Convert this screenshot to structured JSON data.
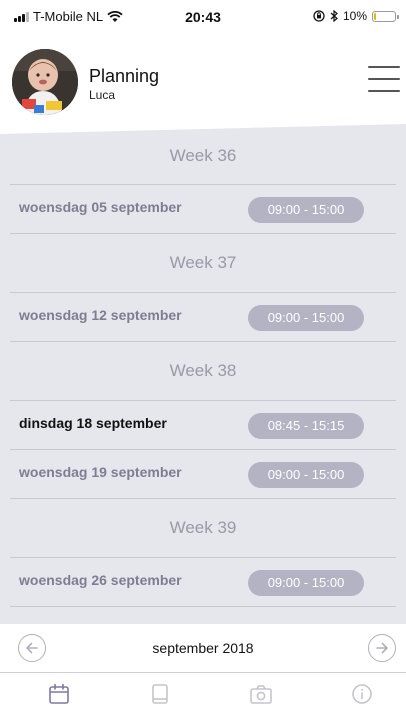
{
  "status_bar": {
    "carrier": "T-Mobile NL",
    "time": "20:43",
    "battery": "10%"
  },
  "header": {
    "title": "Planning",
    "subtitle": "Luca"
  },
  "schedule": {
    "weeks": [
      {
        "label": "Week 36",
        "days": [
          {
            "label": "woensdag 05 september",
            "time": "09:00 - 15:00",
            "current": false
          }
        ]
      },
      {
        "label": "Week 37",
        "days": [
          {
            "label": "woensdag 12 september",
            "time": "09:00 - 15:00",
            "current": false
          }
        ]
      },
      {
        "label": "Week 38",
        "days": [
          {
            "label": "dinsdag 18 september",
            "time": "08:45 - 15:15",
            "current": true
          },
          {
            "label": "woensdag 19 september",
            "time": "09:00 - 15:00",
            "current": false
          }
        ]
      },
      {
        "label": "Week 39",
        "days": [
          {
            "label": "woensdag 26 september",
            "time": "09:00 - 15:00",
            "current": false
          }
        ]
      }
    ]
  },
  "month_nav": {
    "label": "september 2018"
  },
  "tabs": [
    {
      "icon": "calendar-icon",
      "active": true
    },
    {
      "icon": "book-icon",
      "active": false
    },
    {
      "icon": "camera-icon",
      "active": false
    },
    {
      "icon": "info-icon",
      "active": false
    }
  ],
  "colors": {
    "accent": "#7d7aa6",
    "schedule_background": "#e6e6ed",
    "time_pill": "#b3b3c4",
    "week_header_text": "#9a99a8",
    "inactive_day_text": "#7e7e93"
  }
}
